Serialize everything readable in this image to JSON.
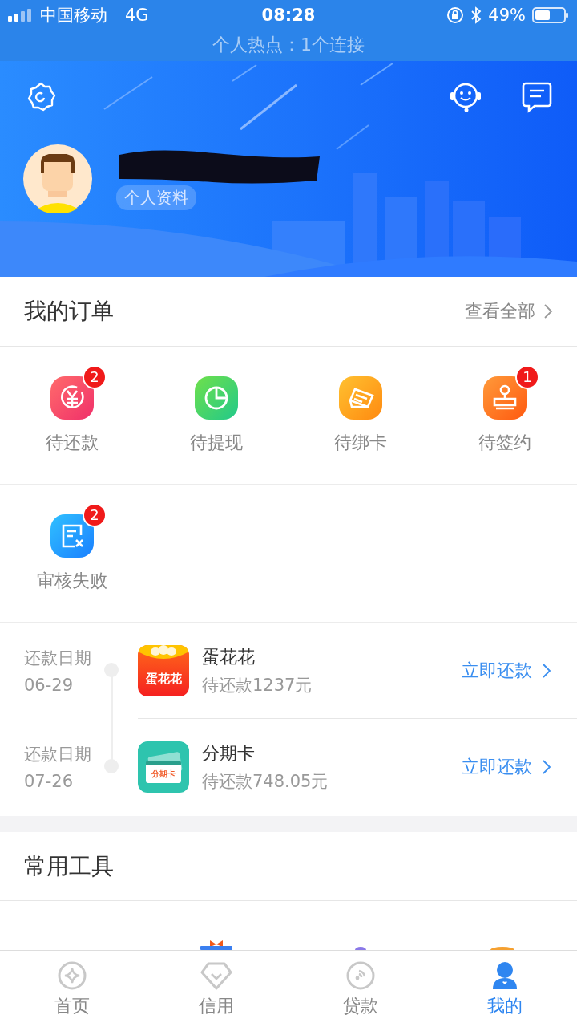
{
  "status_bar": {
    "carrier": "中国移动",
    "network": "4G",
    "time": "08:28",
    "battery": "49%",
    "hotspot": "个人热点：1个连接"
  },
  "profile": {
    "link": "个人资料"
  },
  "orders": {
    "title": "我的订单",
    "view_all": "查看全部",
    "items": [
      {
        "label": "待还款",
        "badge": "2",
        "kind": "repay"
      },
      {
        "label": "待提现",
        "kind": "withdraw"
      },
      {
        "label": "待绑卡",
        "kind": "card"
      },
      {
        "label": "待签约",
        "badge": "1",
        "kind": "sign"
      },
      {
        "label": "审核失败",
        "badge": "2",
        "kind": "failed"
      }
    ]
  },
  "repayments": [
    {
      "date_label": "还款日期",
      "date": "06-29",
      "name": "蛋花花",
      "logo_text": "蛋花花",
      "kind": "egg",
      "amount": "待还款1237元",
      "action": "立即还款"
    },
    {
      "date_label": "还款日期",
      "date": "07-26",
      "name": "分期卡",
      "logo_text": "分期卡",
      "kind": "installment",
      "amount": "待还款748.05元",
      "action": "立即还款"
    }
  ],
  "tools": {
    "title": "常用工具"
  },
  "tabs": [
    {
      "label": "首页",
      "kind": "home",
      "selected": false
    },
    {
      "label": "信用",
      "kind": "credit",
      "selected": false
    },
    {
      "label": "贷款",
      "kind": "loan",
      "selected": false
    },
    {
      "label": "我的",
      "kind": "me",
      "selected": true
    }
  ]
}
